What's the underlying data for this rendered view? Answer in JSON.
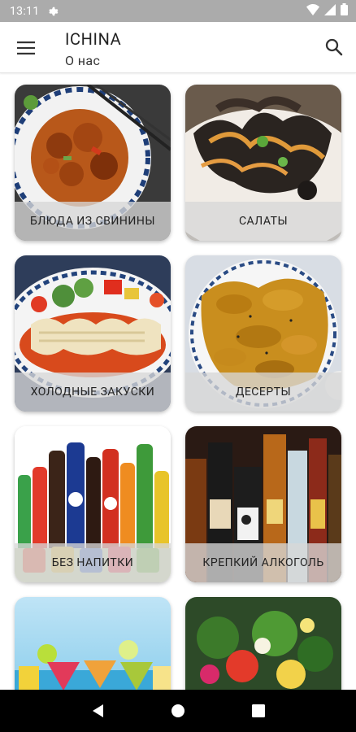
{
  "status_bar": {
    "time": "13:11",
    "icons": [
      "gear-icon",
      "wifi-icon",
      "signal-icon",
      "battery-icon"
    ]
  },
  "app_bar": {
    "title": "ICHINA",
    "subtitle": "О нас",
    "menu_icon": "hamburger-menu-icon",
    "search_icon": "search-icon"
  },
  "categories": [
    {
      "label": "БЛЮДА ИЗ СВИНИНЫ"
    },
    {
      "label": "САЛАТЫ"
    },
    {
      "label": "ХОЛОДНЫЕ ЗАКУСКИ"
    },
    {
      "label": "ДЕСЕРТЫ"
    },
    {
      "label": "БЕЗ НАПИТКИ"
    },
    {
      "label": "КРЕПКИЙ АЛКОГОЛЬ"
    },
    {
      "label": ""
    },
    {
      "label": ""
    }
  ],
  "nav_bar": {
    "icons": [
      "back-icon",
      "home-icon",
      "recents-icon"
    ]
  },
  "colors": {
    "status_bar": "#ababab",
    "nav_bar": "#000000",
    "label_overlay": "#d7d7d7"
  }
}
